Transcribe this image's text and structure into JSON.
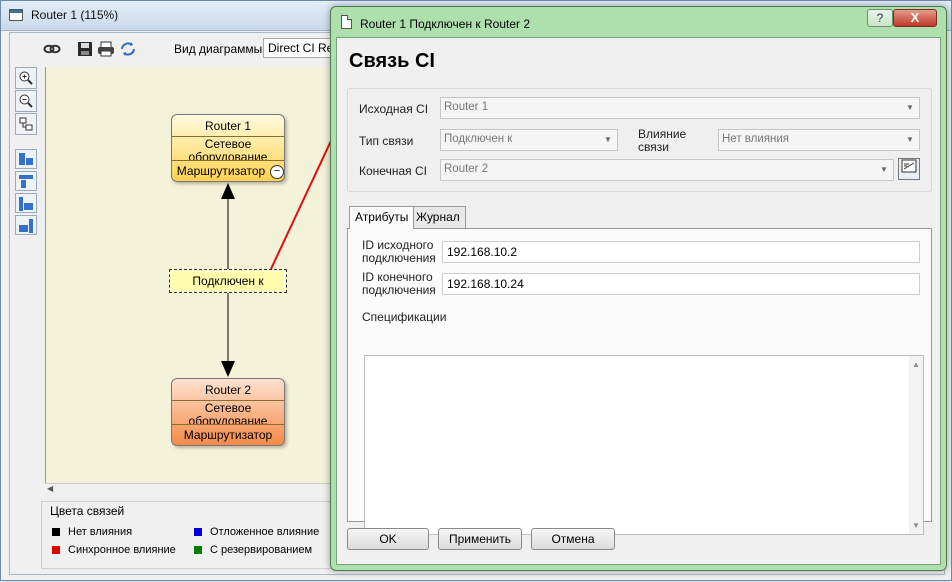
{
  "main_window": {
    "title": "Router 1 (115%)",
    "toolbar": {
      "diagram_type_label": "Вид диаграммы",
      "diagram_type_value": "Direct CI Relations"
    },
    "diagram": {
      "node1": {
        "name": "Router 1",
        "type": "Сетевое оборудование",
        "category": "Маршрутизатор"
      },
      "node2": {
        "name": "Router 2",
        "type": "Сетевое оборудование",
        "category": "Маршрутизатор"
      },
      "link_label": "Подключен к"
    },
    "legend": {
      "title": "Цвета связей",
      "items": [
        {
          "label": "Нет влияния",
          "color": "#000000"
        },
        {
          "label": "Синхронное влияние",
          "color": "#e00000"
        },
        {
          "label": "Отложенное влияние",
          "color": "#0000e0"
        },
        {
          "label": "С резервированием",
          "color": "#008000"
        }
      ]
    }
  },
  "dialog": {
    "title": "Router 1 Подключен к Router 2",
    "help_label": "?",
    "close_label": "X",
    "heading": "Связь CI",
    "fields": {
      "source_ci_label": "Исходная CI",
      "source_ci_value": "Router 1",
      "link_type_label": "Тип связи",
      "link_type_value": "Подключен к",
      "impact_label": "Влияние связи",
      "impact_value": "Нет влияния",
      "target_ci_label": "Конечная CI",
      "target_ci_value": "Router 2"
    },
    "tabs": [
      "Атрибуты",
      "Журнал"
    ],
    "attributes": {
      "source_conn_id_label": "ID исходного подключения",
      "source_conn_id_value": "192.168.10.2",
      "target_conn_id_label": "ID конечного подключения",
      "target_conn_id_value": "192.168.10.24",
      "spec_label": "Спецификации",
      "spec_value": ""
    },
    "buttons": {
      "ok": "OK",
      "apply": "Применить",
      "cancel": "Отмена"
    }
  }
}
